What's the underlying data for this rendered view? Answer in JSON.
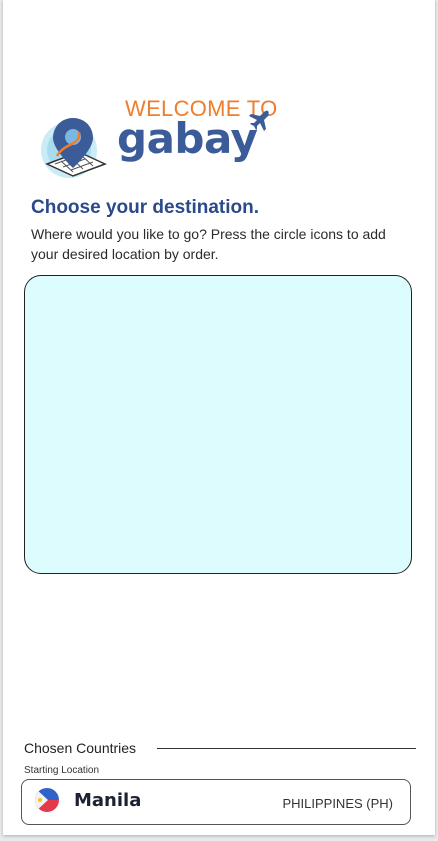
{
  "header": {
    "welcome_text": "WELCOME TO",
    "brand_name": "gabay"
  },
  "intro": {
    "title": "Choose your destination.",
    "description": "Where would you like to go? Press the circle icons to add your desired location by order."
  },
  "chosen": {
    "section_label": "Chosen Countries",
    "starting_label": "Starting Location",
    "start": {
      "city": "Manila",
      "country": "PHILIPPINES (PH)",
      "flag_icon": "philippines-flag-icon"
    }
  },
  "colors": {
    "brand_orange": "#ef7d2d",
    "brand_blue": "#3b5c99",
    "map_fill": "#dcfcfd"
  }
}
